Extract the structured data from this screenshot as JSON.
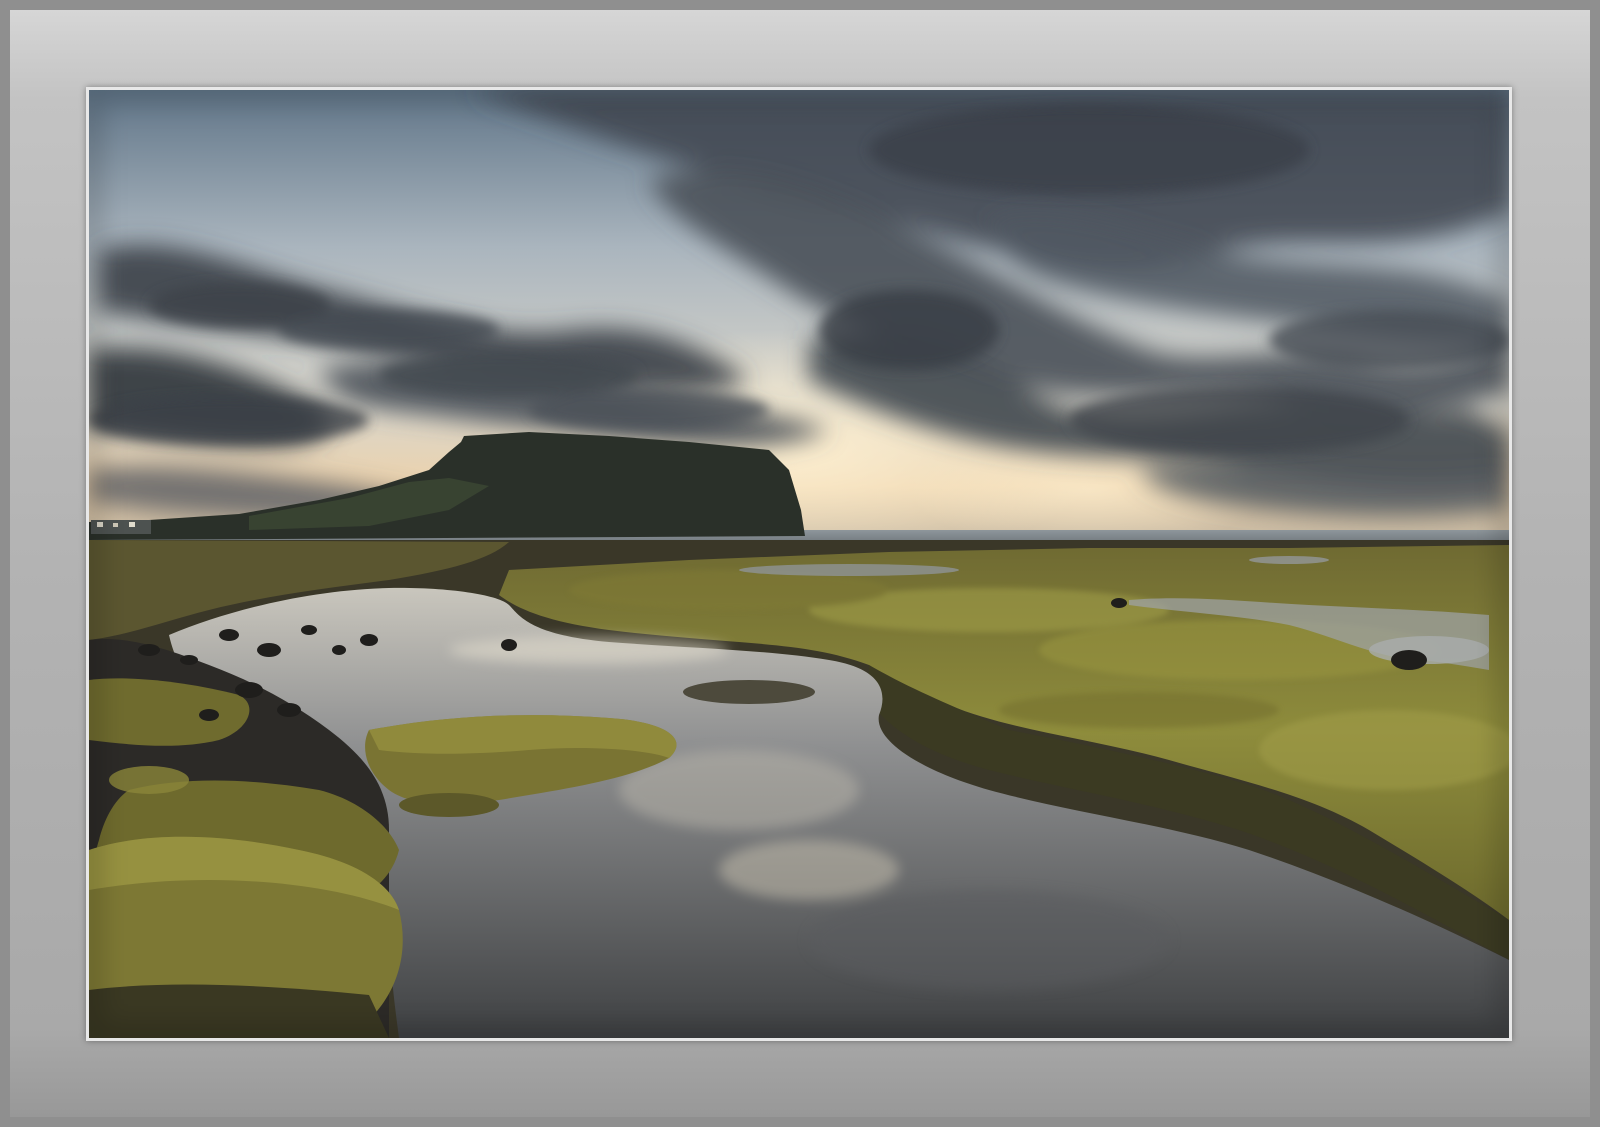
{
  "scene": {
    "subject": "coastal-landscape",
    "colors": {
      "sky_top": "#6f8294",
      "sky_mid": "#c9cdd0",
      "horizon_glow": "#e9c9a0",
      "cloud_dark": "#3c424b",
      "cloud_mid": "#5a626c",
      "headland": "#2b3128",
      "sea": "#6c747c",
      "moss": "#8a8a3a",
      "moss_dark": "#4f4d22",
      "rock_dark": "#2a2826",
      "water": "#7d7f82",
      "mat": "#b8b8b8"
    }
  }
}
